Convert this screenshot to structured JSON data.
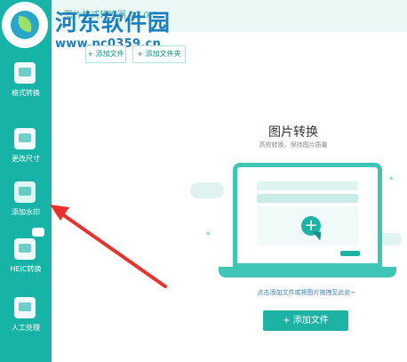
{
  "watermark": {
    "title": "河东软件园",
    "url": "www.pc0359.cn"
  },
  "window": {
    "title_partial": "图片格式转换器 V1.0.0"
  },
  "toolbar": {
    "add_file_label": "+ 添加文件",
    "add_folder_label": "+ 添加文件夹"
  },
  "sidebar": {
    "items": [
      {
        "label": "格式转换",
        "icon": "image-convert-icon"
      },
      {
        "label": "更改尺寸",
        "icon": "resize-icon"
      },
      {
        "label": "添加水印",
        "icon": "watermark-icon"
      },
      {
        "label": "HEIC转换",
        "icon": "heic-icon"
      },
      {
        "label": "人工处理",
        "icon": "manual-process-icon"
      }
    ],
    "active_index": 2
  },
  "main": {
    "title": "图片转换",
    "subtitle": "高效转换，保持图片质量",
    "hint": "点击添加文件或将图片拖拽至此处~",
    "add_button_label": "+ 添加文件"
  },
  "colors": {
    "accent": "#17b3a6",
    "arrow": "#e8322f",
    "watermark": "#1b7fbe"
  }
}
